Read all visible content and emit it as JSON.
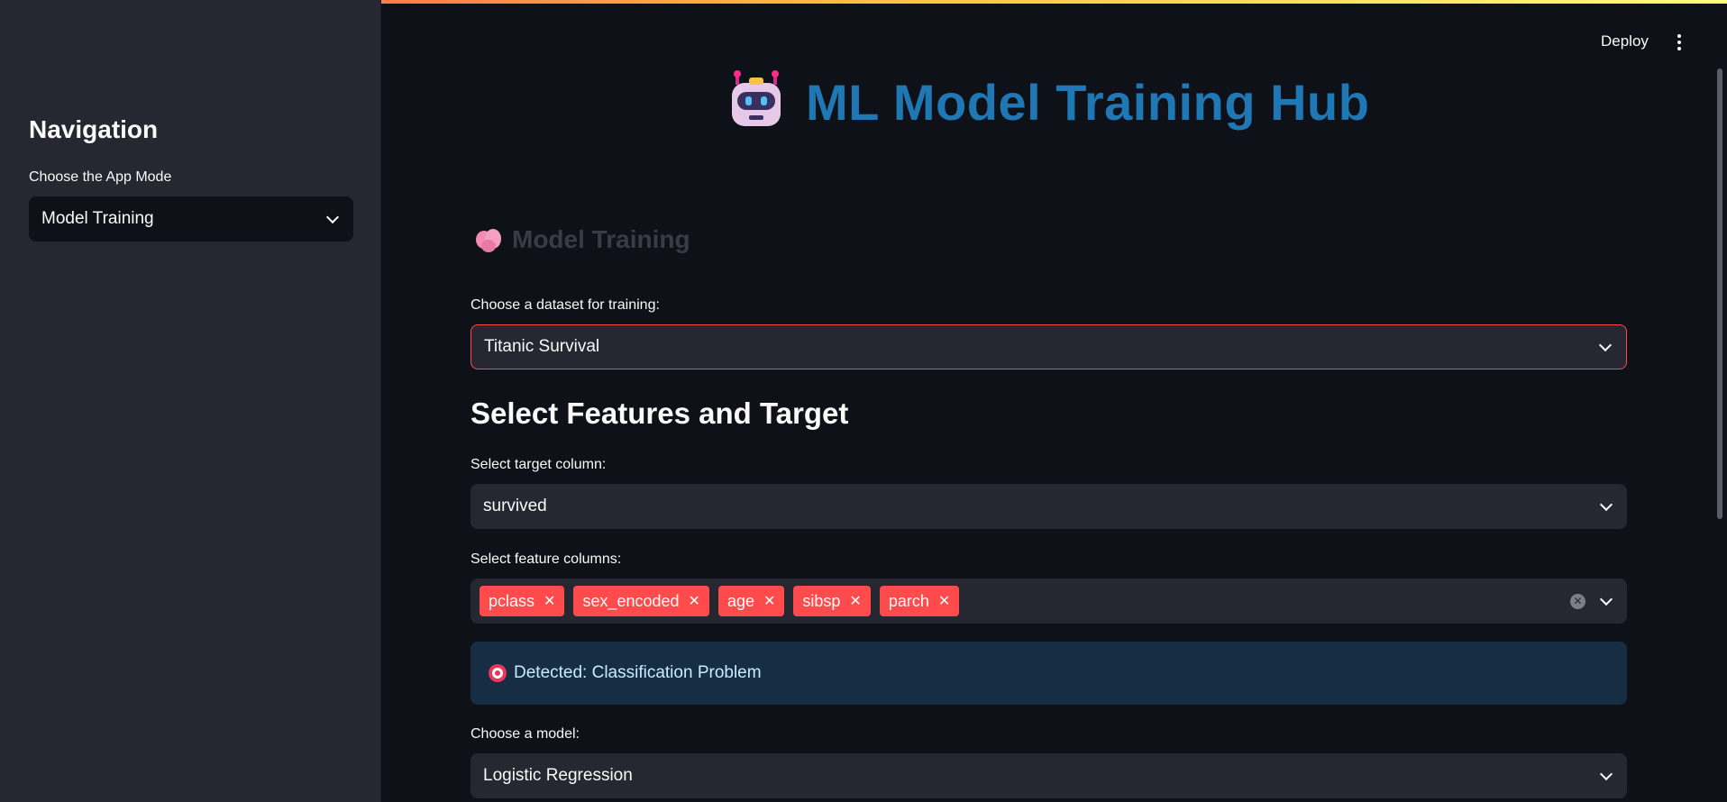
{
  "topbar": {
    "deploy_label": "Deploy",
    "menu_icon": "more-vertical-icon"
  },
  "sidebar": {
    "title": "Navigation",
    "mode_label": "Choose the App Mode",
    "mode_value": "Model Training"
  },
  "header": {
    "icon": "robot-icon",
    "title": "ML Model Training Hub"
  },
  "section": {
    "icon": "brain-icon",
    "title": "Model Training"
  },
  "dataset": {
    "label": "Choose a dataset for training:",
    "value": "Titanic Survival"
  },
  "features_section": {
    "title": "Select Features and Target"
  },
  "target": {
    "label": "Select target column:",
    "value": "survived"
  },
  "features": {
    "label": "Select feature columns:",
    "tags": [
      "pclass",
      "sex_encoded",
      "age",
      "sibsp",
      "parch"
    ]
  },
  "info": {
    "icon": "target-icon",
    "text": "Detected: Classification Problem"
  },
  "model": {
    "label": "Choose a model:",
    "value": "Logistic Regression"
  },
  "colors": {
    "accent": "#ff4b4b",
    "title": "#1f77b4",
    "info_bg": "#172d43"
  }
}
